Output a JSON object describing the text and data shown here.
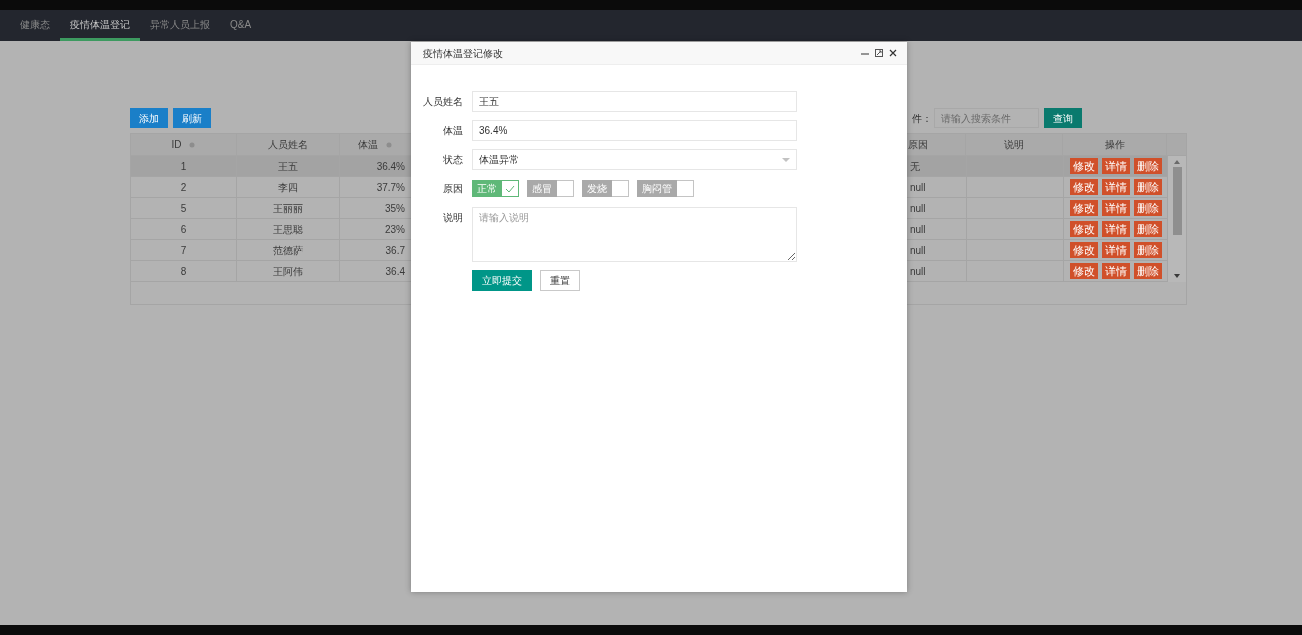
{
  "nav": {
    "tabs": [
      {
        "label": "健康态",
        "selected": false
      },
      {
        "label": "疫情体温登记",
        "selected": true
      },
      {
        "label": "异常人员上报",
        "selected": false
      },
      {
        "label": "Q&A",
        "selected": false
      }
    ]
  },
  "toolbar": {
    "buttons": [
      "添加",
      "刷新"
    ],
    "search_label": "件：",
    "search": {
      "placeholder": "请输入搜索条件"
    },
    "search_button": "查询"
  },
  "table": {
    "columns_left": [
      {
        "label": "ID",
        "sortable": true
      },
      {
        "label": "人员姓名",
        "sortable": false
      },
      {
        "label": "体温",
        "sortable": true
      }
    ],
    "columns_right": [
      "原因",
      "说明",
      "操作"
    ],
    "rows": [
      {
        "id": "1",
        "name": "王五",
        "temp": "36.4%",
        "reason": "无",
        "selected": true,
        "actions": [
          "修改",
          "详情",
          "删除"
        ]
      },
      {
        "id": "2",
        "name": "李四",
        "temp": "37.7%",
        "reason": "null",
        "selected": false,
        "actions": [
          "修改",
          "详情",
          "删除"
        ]
      },
      {
        "id": "5",
        "name": "王丽丽",
        "temp": "35%",
        "reason": "null",
        "selected": false,
        "actions": [
          "修改",
          "详情",
          "删除"
        ]
      },
      {
        "id": "6",
        "name": "王思聪",
        "temp": "23%",
        "reason": "null",
        "selected": false,
        "actions": [
          "修改",
          "详情",
          "删除"
        ]
      },
      {
        "id": "7",
        "name": "范德萨",
        "temp": "36.7",
        "reason": "null",
        "selected": false,
        "actions": [
          "修改",
          "详情",
          "删除"
        ]
      },
      {
        "id": "8",
        "name": "王阿伟",
        "temp": "36.4",
        "reason": "null",
        "selected": false,
        "actions": [
          "修改",
          "详情",
          "删除"
        ]
      }
    ]
  },
  "modal": {
    "title": "疫情体温登记修改",
    "fields": [
      {
        "kind": "text",
        "label": "人员姓名",
        "value": "王五"
      },
      {
        "kind": "text",
        "label": "体温",
        "value": "36.4%"
      },
      {
        "kind": "select",
        "label": "状态",
        "value": "体温异常"
      },
      {
        "kind": "checkboxes",
        "label": "原因",
        "options": [
          {
            "label": "正常",
            "checked": true
          },
          {
            "label": "感冒",
            "checked": false
          },
          {
            "label": "发烧",
            "checked": false
          },
          {
            "label": "胸闷管",
            "checked": false
          }
        ]
      },
      {
        "kind": "textarea",
        "label": "说明",
        "placeholder": "请输入说明"
      }
    ],
    "buttons": [
      {
        "label": "立即提交",
        "kind": "primary"
      },
      {
        "label": "重置",
        "kind": "default"
      }
    ]
  }
}
